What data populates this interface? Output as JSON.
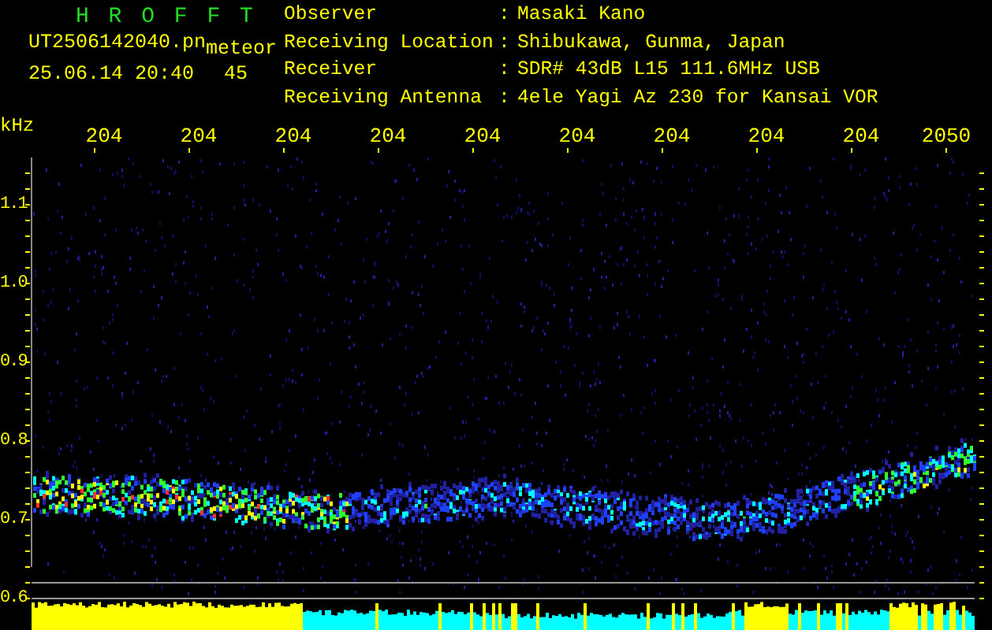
{
  "app_title": "H R O F F T",
  "file_name": "UT2506142040.pn",
  "event_type": "meteor",
  "timestamp": "25.06.14 20:40",
  "count": "45",
  "info": [
    {
      "label": "Observer",
      "separator": ":",
      "value": "Masaki Kano"
    },
    {
      "label": "Receiving Location",
      "separator": ":",
      "value": "Shibukawa, Gunma, Japan"
    },
    {
      "label": "Receiver",
      "separator": ":",
      "value": "SDR# 43dB L15 111.6MHz USB"
    },
    {
      "label": "Receiving Antenna",
      "separator": ":",
      "value": "4ele Yagi Az 230 for Kansai VOR"
    }
  ],
  "x_axis": {
    "unit": "kHz",
    "labels": [
      "204",
      "204",
      "204",
      "204",
      "204",
      "204",
      "204",
      "204",
      "204",
      "2050"
    ]
  },
  "y_axis": {
    "labels": [
      "1.1",
      "1.0",
      "0.9",
      "0.8",
      "0.7",
      "0.6"
    ]
  }
}
